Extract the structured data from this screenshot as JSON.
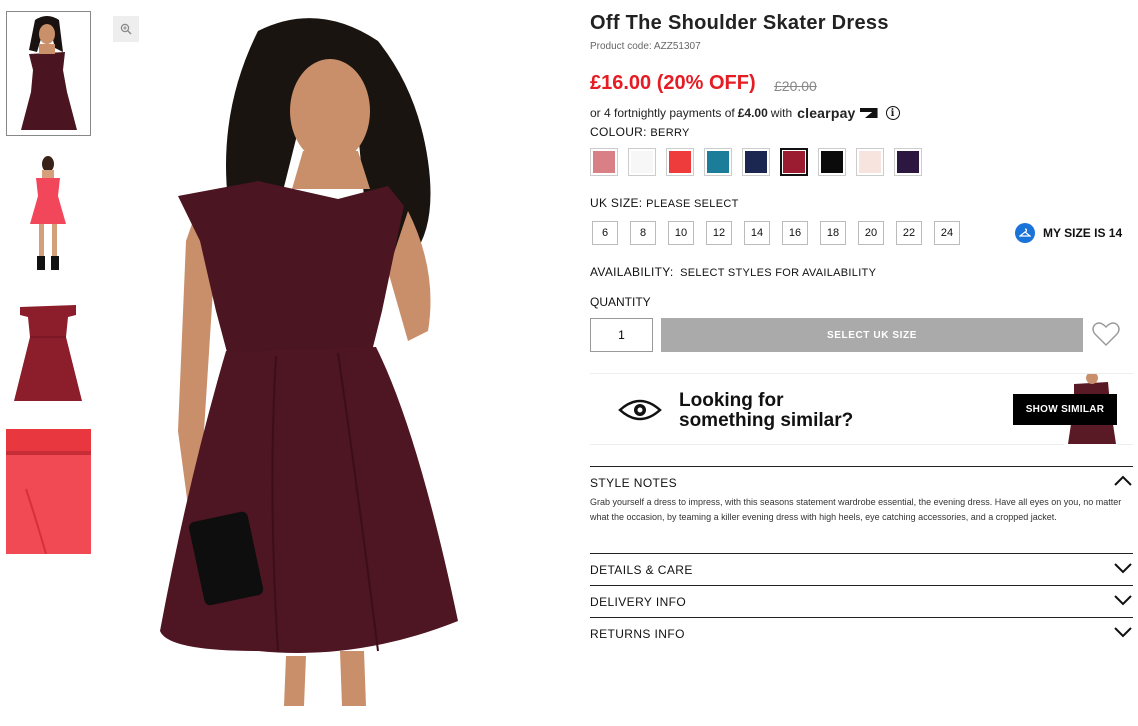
{
  "product": {
    "title": "Off The Shoulder Skater Dress",
    "code": "Product code: AZZ51307",
    "price": "£16.00 (20% OFF)",
    "was_price": "£20.00",
    "installments_prefix": "or 4 fortnightly payments of",
    "installments_amount": "£4.00",
    "installments_with": "with",
    "clearpay": "clearpay"
  },
  "colour": {
    "label": "COLOUR:",
    "selected": "BERRY",
    "swatches": [
      "#d97f86",
      "#f7f7f7",
      "#ee3b3b",
      "#1c7d9a",
      "#1b2750",
      "#9b1b30",
      "#0b0b0b",
      "#f7e4df",
      "#2b1740"
    ]
  },
  "size": {
    "label": "UK SIZE:",
    "hint": "PLEASE SELECT",
    "options": [
      "6",
      "8",
      "10",
      "12",
      "14",
      "16",
      "18",
      "20",
      "22",
      "24"
    ],
    "my_size": "MY SIZE IS 14"
  },
  "availability": {
    "label": "AVAILABILITY:",
    "value": "SELECT STYLES FOR AVAILABILITY"
  },
  "quantity": {
    "label": "QUANTITY",
    "value": "1",
    "add_button": "SELECT UK SIZE"
  },
  "similar": {
    "line1": "Looking for",
    "line2": "something similar?",
    "button": "SHOW SIMILAR"
  },
  "accordion": {
    "style_notes": {
      "title": "STYLE NOTES",
      "body": "Grab yourself a dress to impress, with this seasons statement wardrobe essential, the evening dress. Have all eyes on you, no matter what the occasion, by teaming a killer evening dress with high heels, eye catching accessories, and a cropped jacket."
    },
    "details": "DETAILS & CARE",
    "delivery": "DELIVERY INFO",
    "returns": "RETURNS INFO"
  }
}
